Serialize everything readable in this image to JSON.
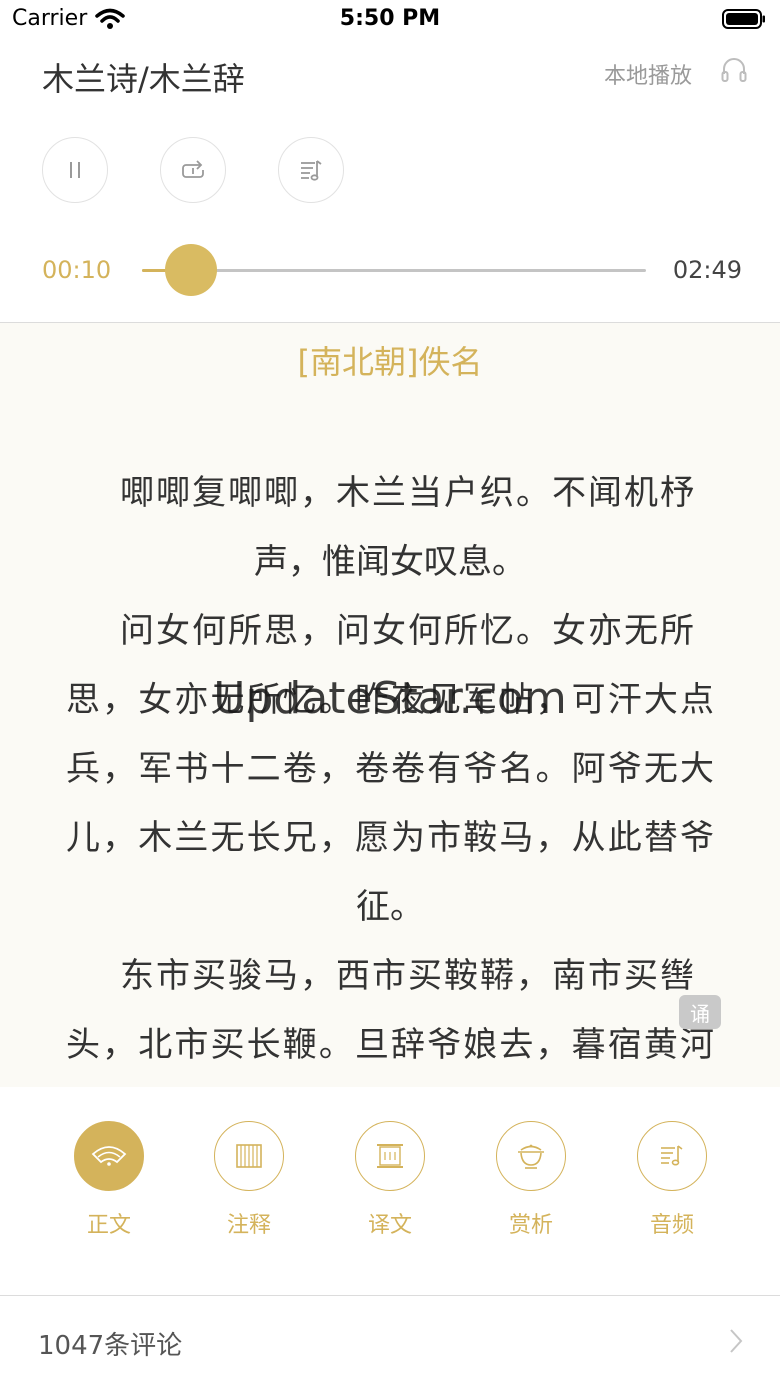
{
  "status": {
    "carrier": "Carrier",
    "time": "5:50 PM"
  },
  "header": {
    "title": "木兰诗/木兰辞",
    "local_play": "本地播放"
  },
  "player": {
    "current_time": "00:10",
    "total_time": "02:49",
    "progress": 0.097
  },
  "poem": {
    "author": "[南北朝]佚名",
    "lines": [
      "唧唧复唧唧，木兰当户织。不闻机杼",
      "声，惟闻女叹息。",
      "问女何所思，问女何所忆。女亦无所",
      "思，女亦无所忆。昨夜见军帖，可汗大点",
      "兵，军书十二卷，卷卷有爷名。阿爷无大",
      "儿，木兰无长兄，愿为市鞍马，从此替爷",
      "征。",
      "东市买骏马，西市买鞍鞯，南市买辔",
      "头，北市买长鞭。旦辞爷娘去，暮宿黄河"
    ],
    "watermark": "UpdateStar.com",
    "recite_badge": "诵"
  },
  "tabs": [
    {
      "label": "正文",
      "icon": "fan-icon",
      "active": true
    },
    {
      "label": "注释",
      "icon": "bamboo-slips-icon",
      "active": false
    },
    {
      "label": "译文",
      "icon": "scroll-icon",
      "active": false
    },
    {
      "label": "赏析",
      "icon": "tea-cup-icon",
      "active": false
    },
    {
      "label": "音频",
      "icon": "playlist-icon",
      "active": false
    }
  ],
  "comments": {
    "label": "1047条评论"
  },
  "colors": {
    "accent": "#d4b35b",
    "poem_bg": "#fbfaf5",
    "divider": "#dcdcdc"
  }
}
